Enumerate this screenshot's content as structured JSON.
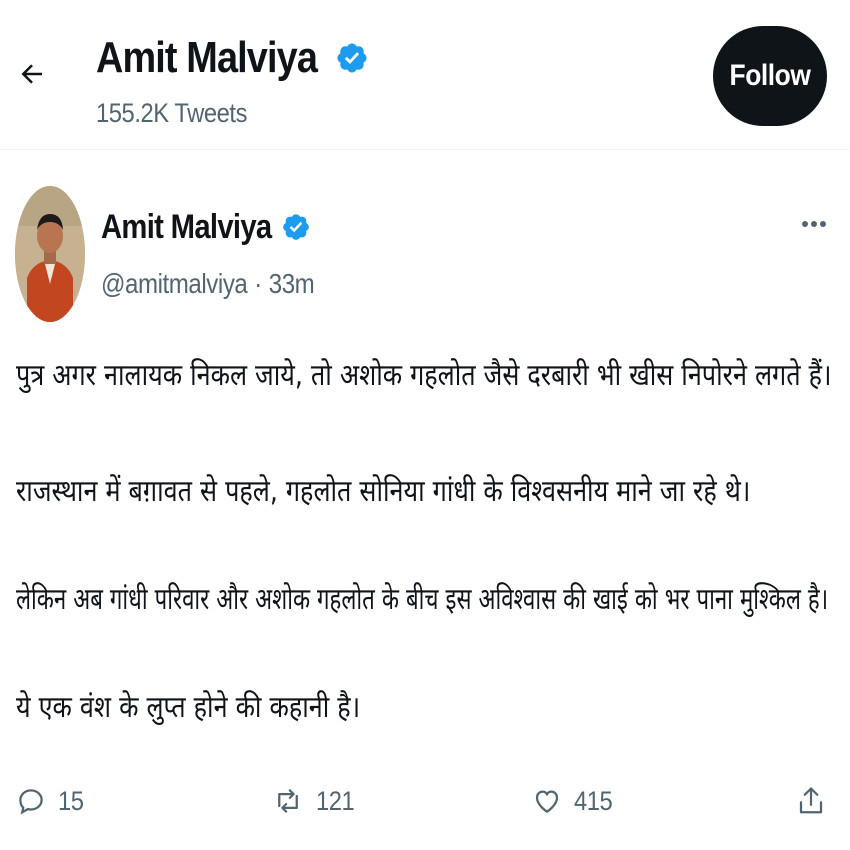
{
  "header": {
    "title": "Amit Malviya",
    "tweet_count": "155.2K Tweets",
    "follow_label": "Follow"
  },
  "tweet": {
    "author_name": "Amit Malviya",
    "handle": "@amitmalviya",
    "separator": "·",
    "time": "33m",
    "lines": [
      "पुत्र अगर नालायक निकल जाये, तो अशोक गहलोत जैसे दरबारी भी खीस निपोरने लगते हैं।",
      "राजस्थान में बग़ावत से पहले, गहलोत सोनिया गांधी के विश्वसनीय माने जा रहे थे।",
      "लेकिन अब गांधी परिवार और अशोक गहलोत के बीच इस अविश्वास की खाई को भर पाना मुश्किल है।",
      "ये एक वंश के लुप्त होने की कहानी है।"
    ],
    "replies": "15",
    "retweets": "121",
    "likes": "415"
  },
  "icons": {
    "back": "back-arrow-icon",
    "verified": "verified-badge-icon",
    "more": "more-horizontal-icon",
    "reply": "reply-icon",
    "retweet": "retweet-icon",
    "like": "heart-icon",
    "share": "share-icon"
  },
  "colors": {
    "verified": "#1d9bf0",
    "follow_bg": "#0f1419",
    "secondary_text": "#536471"
  }
}
